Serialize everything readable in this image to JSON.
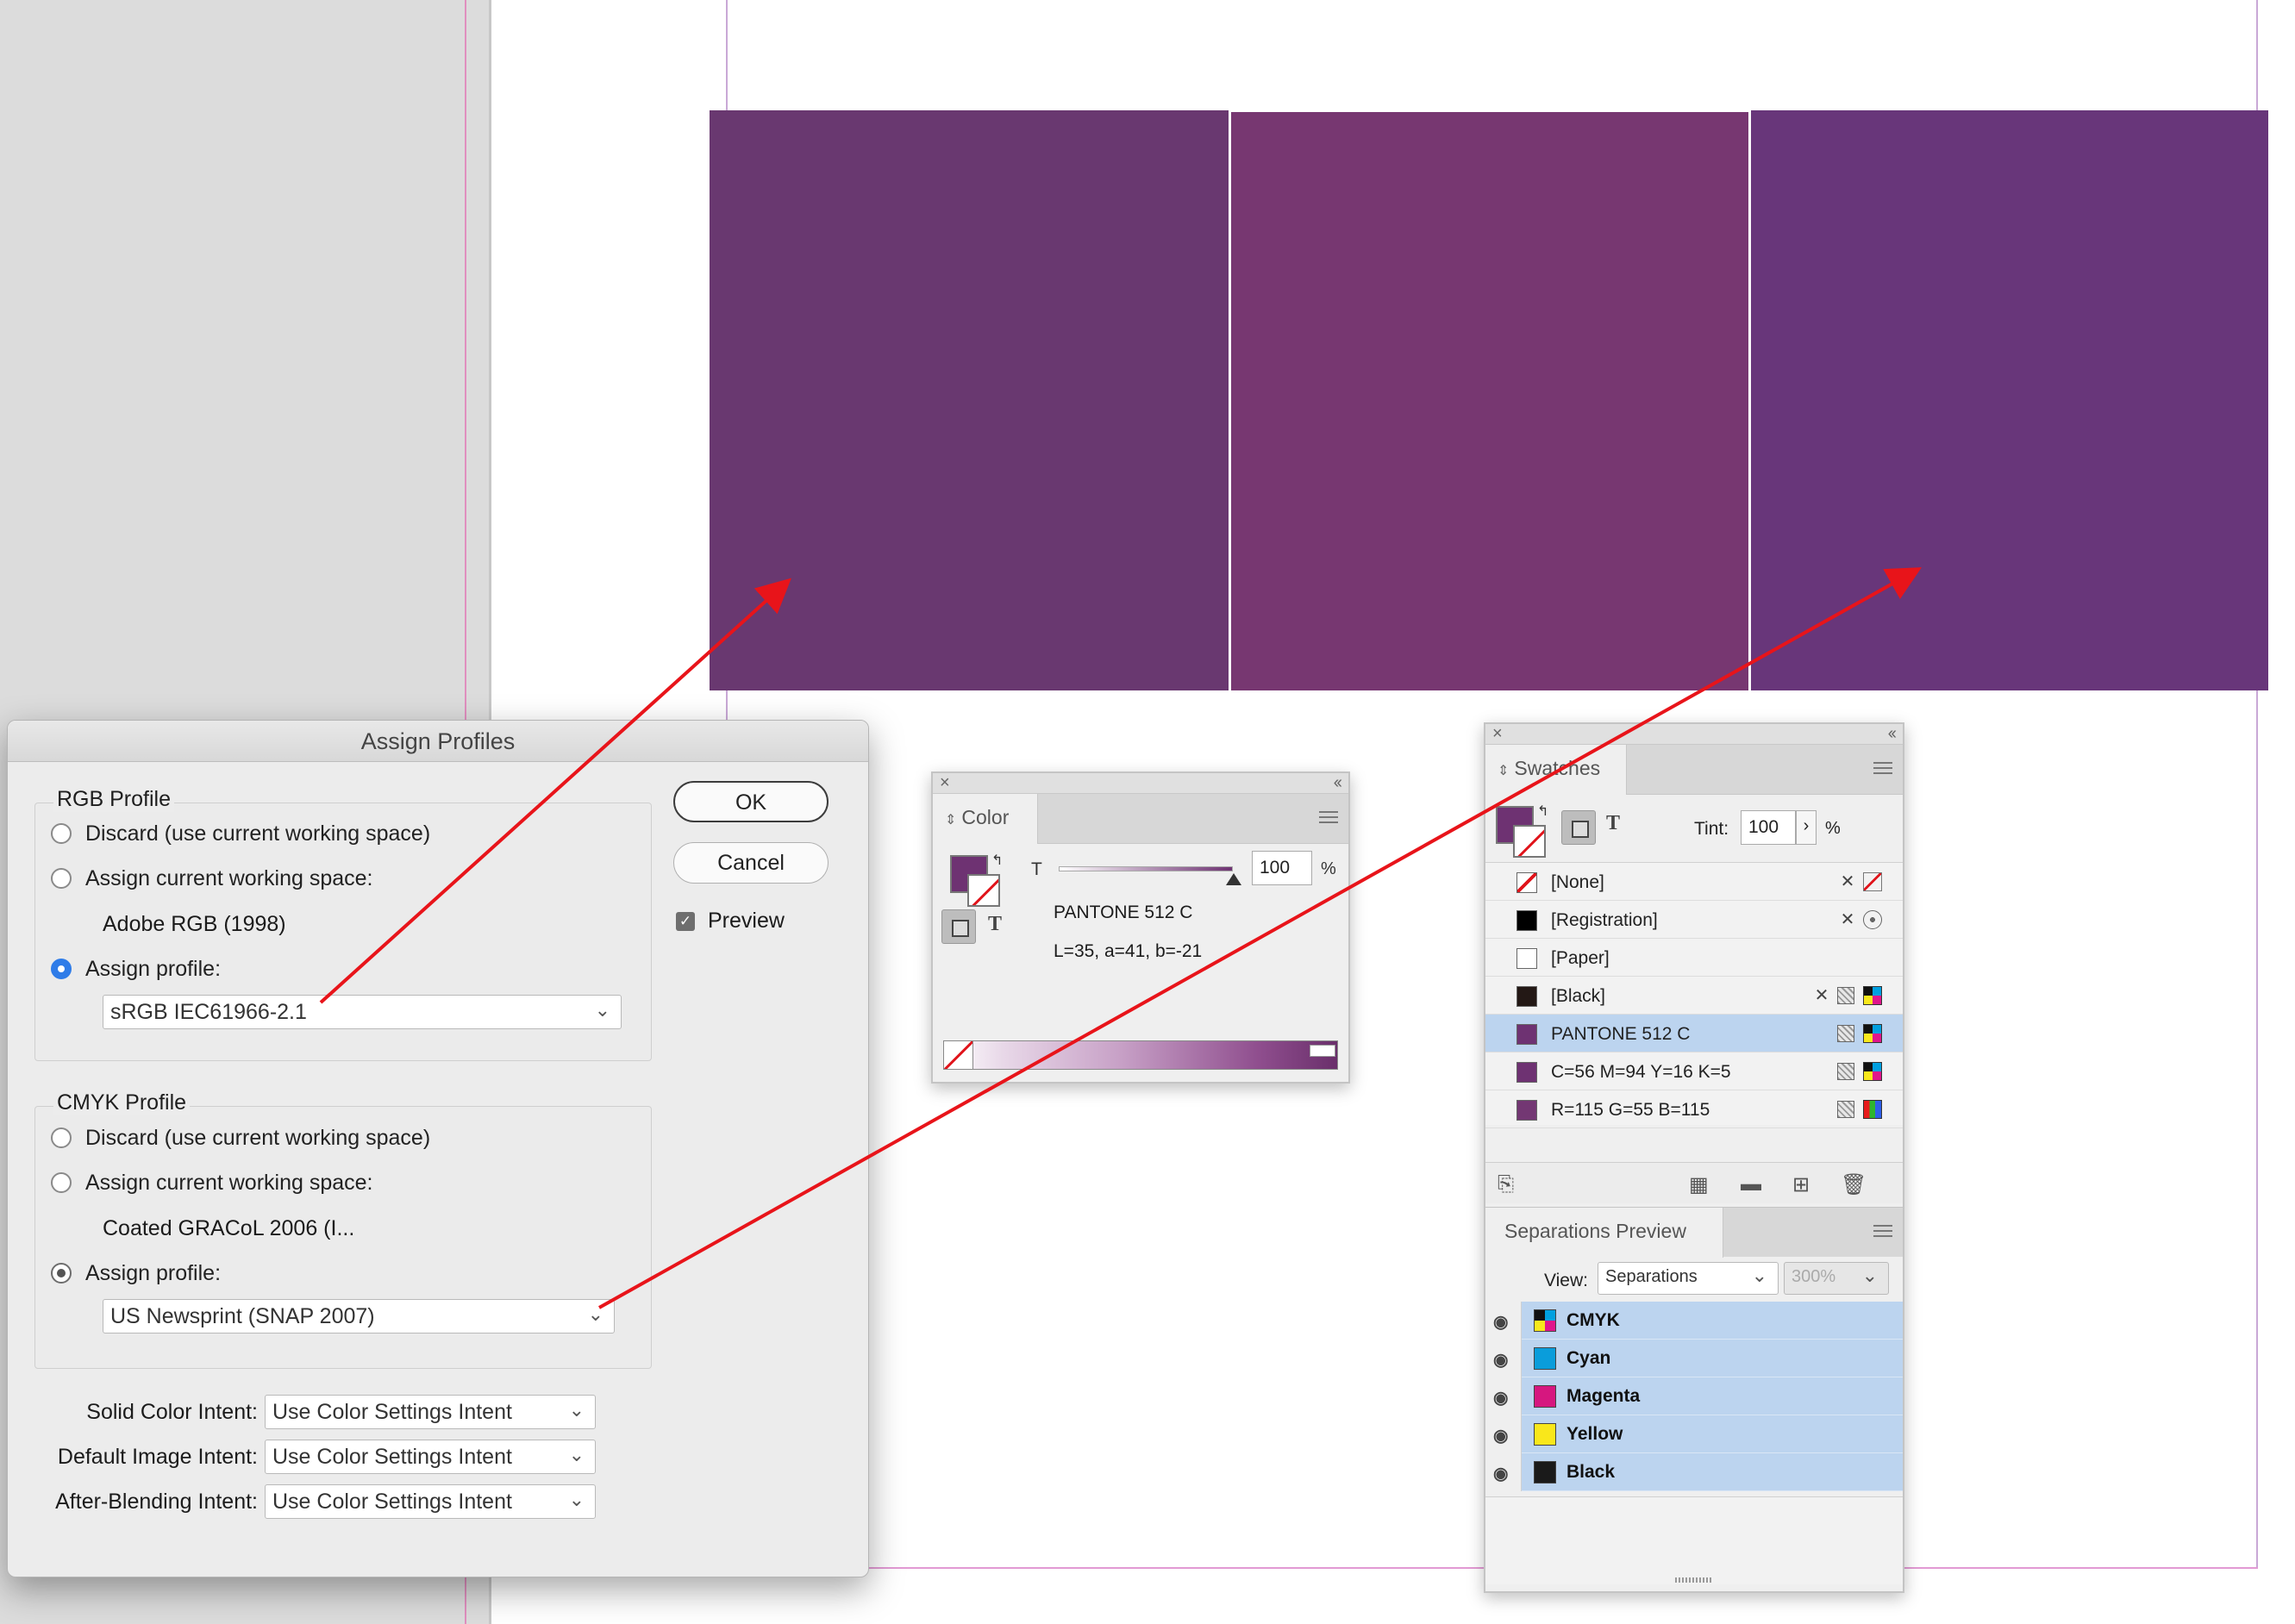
{
  "canvas": {
    "swatch_colors": [
      "#693870",
      "#773771",
      "#68367a"
    ]
  },
  "dialog": {
    "title": "Assign Profiles",
    "rgb_group": {
      "title": "RGB Profile",
      "discard_label": "Discard (use current working space)",
      "assign_current_label": "Assign current working space:",
      "current_space": "Adobe RGB (1998)",
      "assign_profile_label": "Assign profile:",
      "profile_value": "sRGB IEC61966-2.1",
      "selected": "assign_profile"
    },
    "cmyk_group": {
      "title": "CMYK Profile",
      "discard_label": "Discard (use current working space)",
      "assign_current_label": "Assign current working space:",
      "current_space": "Coated GRACoL 2006 (I...",
      "assign_profile_label": "Assign profile:",
      "profile_value": "US Newsprint (SNAP 2007)",
      "selected": "assign_profile"
    },
    "buttons": {
      "ok": "OK",
      "cancel": "Cancel"
    },
    "preview_label": "Preview",
    "preview_checked": true,
    "intents": [
      {
        "label": "Solid Color Intent:",
        "value": "Use Color Settings Intent"
      },
      {
        "label": "Default Image Intent:",
        "value": "Use Color Settings Intent"
      },
      {
        "label": "After-Blending Intent:",
        "value": "Use Color Settings Intent"
      }
    ]
  },
  "color_panel": {
    "tab": "Color",
    "tint_letter": "T",
    "tint_value": "100",
    "tint_unit": "%",
    "swatch_name": "PANTONE 512 C",
    "lab_values": "L=35, a=41, b=-21",
    "fill_color": "#6e3272"
  },
  "swatches_panel": {
    "tab": "Swatches",
    "tint_label": "Tint:",
    "tint_value": "100",
    "tint_unit": "%",
    "fill_color": "#6e3272",
    "swatches": [
      {
        "name": "[None]",
        "color": "none",
        "icons": [
          "x-icon",
          "none-icon"
        ]
      },
      {
        "name": "[Registration]",
        "color": "#000000",
        "icons": [
          "x-icon",
          "registration-icon"
        ]
      },
      {
        "name": "[Paper]",
        "color": "#ffffff",
        "icons": []
      },
      {
        "name": "[Black]",
        "color": "#231815",
        "icons": [
          "x-icon",
          "process-icon",
          "cmyk-icon"
        ]
      },
      {
        "name": "PANTONE 512 C",
        "color": "#6e3272",
        "icons": [
          "process-icon",
          "spot-icon"
        ],
        "selected": true
      },
      {
        "name": "C=56 M=94 Y=16 K=5",
        "color": "#6e3272",
        "icons": [
          "process-icon",
          "cmyk-icon"
        ]
      },
      {
        "name": "R=115 G=55 B=115",
        "color": "#733773",
        "icons": [
          "process-icon",
          "rgb-icon"
        ]
      }
    ]
  },
  "separations_panel": {
    "tab": "Separations Preview",
    "view_label": "View:",
    "view_value": "Separations",
    "zoom_value": "300%",
    "inks": [
      {
        "name": "CMYK",
        "color": "cmyk"
      },
      {
        "name": "Cyan",
        "color": "#0a9ddb"
      },
      {
        "name": "Magenta",
        "color": "#d6177f"
      },
      {
        "name": "Yellow",
        "color": "#f9e71b"
      },
      {
        "name": "Black",
        "color": "#1a1a1a"
      }
    ]
  }
}
